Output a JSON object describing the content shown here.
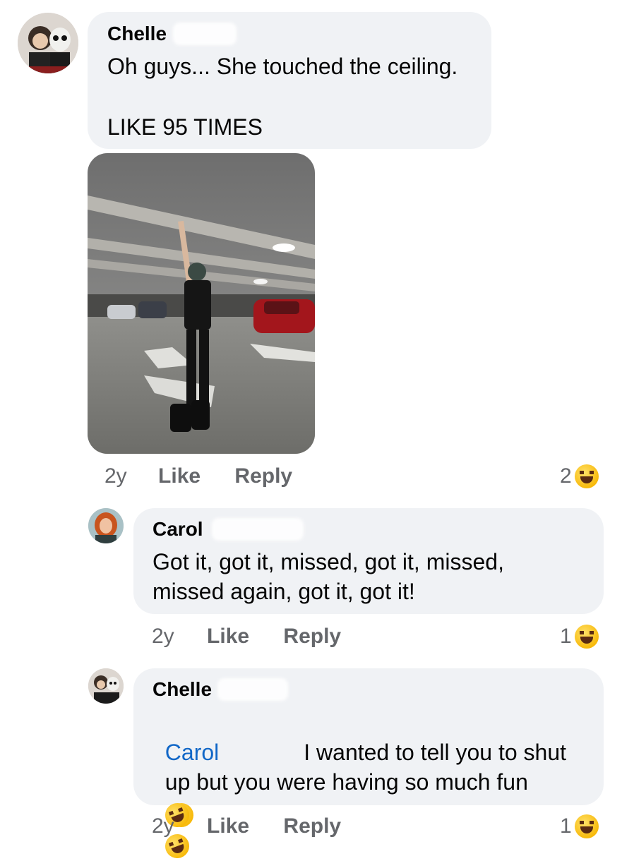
{
  "comments": [
    {
      "author": "Chelle",
      "lines": [
        "Oh guys... She touched the ceiling.",
        "",
        "LIKE 95 TIMES"
      ],
      "time": "2y",
      "like_label": "Like",
      "reply_label": "Reply",
      "reaction_count": "2"
    },
    {
      "author": "Carol",
      "lines": [
        "Got it, got it, missed, got it, missed,",
        "missed again, got it, got it!"
      ],
      "time": "2y",
      "like_label": "Like",
      "reply_label": "Reply",
      "reaction_count": "1"
    },
    {
      "author": "Chelle",
      "mention": "Carol",
      "line1_rest": "I wanted to tell you to shut",
      "line2": "up but you were having so much fun",
      "time": "2y",
      "like_label": "Like",
      "reply_label": "Reply",
      "reaction_count": "1"
    }
  ],
  "icons": {
    "reaction": "laughing-emoji-icon",
    "inline_emoji": "rolling-on-floor-laughing-emoji-icon"
  },
  "colors": {
    "bubble": "#f0f2f5",
    "meta_text": "#65676b",
    "mention": "#1167c7"
  }
}
